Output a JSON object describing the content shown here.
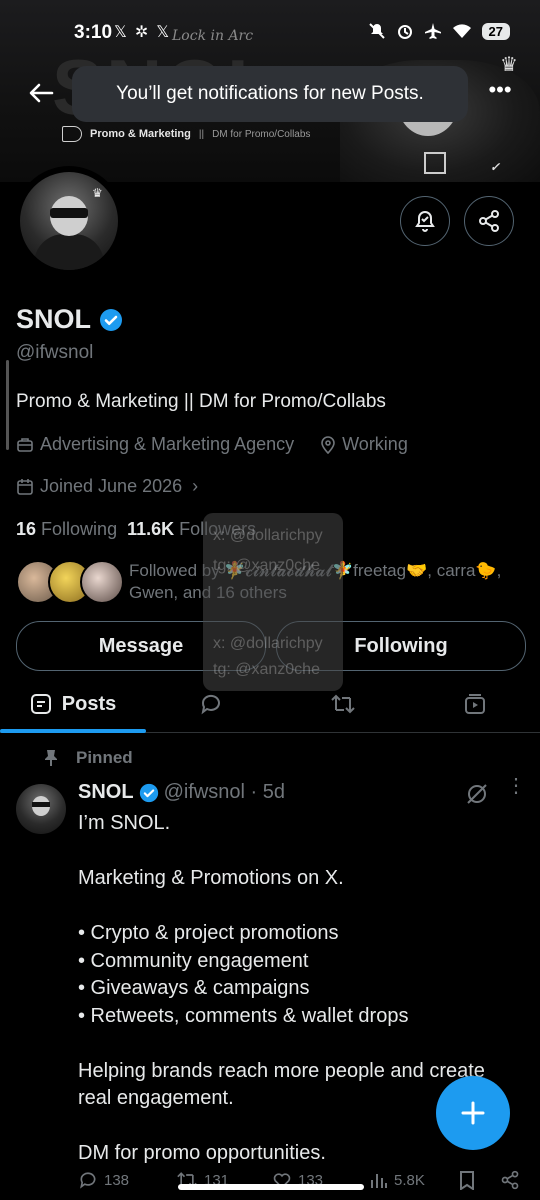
{
  "status_bar": {
    "time": "3:10",
    "left_icons": [
      "x-logo-icon",
      "vpn-icon",
      "x-logo-icon"
    ],
    "right_icons": [
      "mute-icon",
      "alarm-icon",
      "airplane-icon",
      "wifi-icon"
    ],
    "battery": "27"
  },
  "banner": {
    "big_text": "SNOL",
    "script_text": "Lock in Arc",
    "tagline_strong": "Promo & Marketing",
    "tagline_sep": "||",
    "tagline_dim": "DM for Promo/Collabs"
  },
  "toast": {
    "text": "You’ll get notifications for new Posts."
  },
  "profile": {
    "display_name": "SNOL",
    "handle": "@ifwsnol",
    "bio": "Promo & Marketing || DM for Promo/Collabs",
    "category": "Advertising & Marketing Agency",
    "location": "Working",
    "joined": "Joined June 2026",
    "following_count": "16",
    "following_label": "Following",
    "followers_count": "11.6K",
    "followers_label": "Followers",
    "followed_by_line1": "Followed by 🧚𝓬𝓲𝓷𝓽𝓪𝓸𝓭𝓱𝓪𝓽🧚freetag🤝, carra🐤,",
    "followed_by_line2": "Gwen, and 16 others"
  },
  "watermark": {
    "lines": [
      "x: @dollarichpy",
      "tg: @xanz0che",
      "x: @dollarichpy",
      "tg: @xanz0che"
    ]
  },
  "buttons": {
    "message": "Message",
    "following": "Following"
  },
  "tabs": {
    "posts": "Posts"
  },
  "post": {
    "pinned_label": "Pinned",
    "author": "SNOL",
    "meta": "@ifwsnol · 5d",
    "lines": {
      "l1": "I’m SNOL.",
      "l2": "Marketing & Promotions on X.",
      "l3": "• Crypto & project promotions",
      "l4": "• Community engagement",
      "l5": "• Giveaways & campaigns",
      "l6": "• Retweets, comments & wallet drops",
      "l7": "Helping brands reach more people and create real engagement.",
      "l8": "DM for promo opportunities."
    },
    "stats": {
      "replies": "138",
      "reposts": "131",
      "likes": "133",
      "views": "5.8K"
    }
  },
  "colors": {
    "accent": "#1d9bf0",
    "text_primary": "#e7e9ea",
    "text_secondary": "#71767b",
    "border": "#536471"
  }
}
